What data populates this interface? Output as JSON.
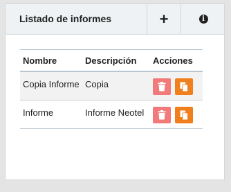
{
  "panel": {
    "title": "Listado de informes",
    "add_icon": "plus-icon",
    "info_icon": "info-icon"
  },
  "table": {
    "headers": [
      "Nombre",
      "Descripción",
      "Acciones"
    ],
    "rows": [
      {
        "name": "Copia Informe",
        "description": "Copia"
      },
      {
        "name": "Informe",
        "description": "Informe Neotel"
      }
    ],
    "action_icons": [
      "trash-icon",
      "copy-icon"
    ]
  },
  "colors": {
    "delete_button": "#f27a7a",
    "copy_button": "#f0801e",
    "header_bg": "#eef2f5"
  }
}
